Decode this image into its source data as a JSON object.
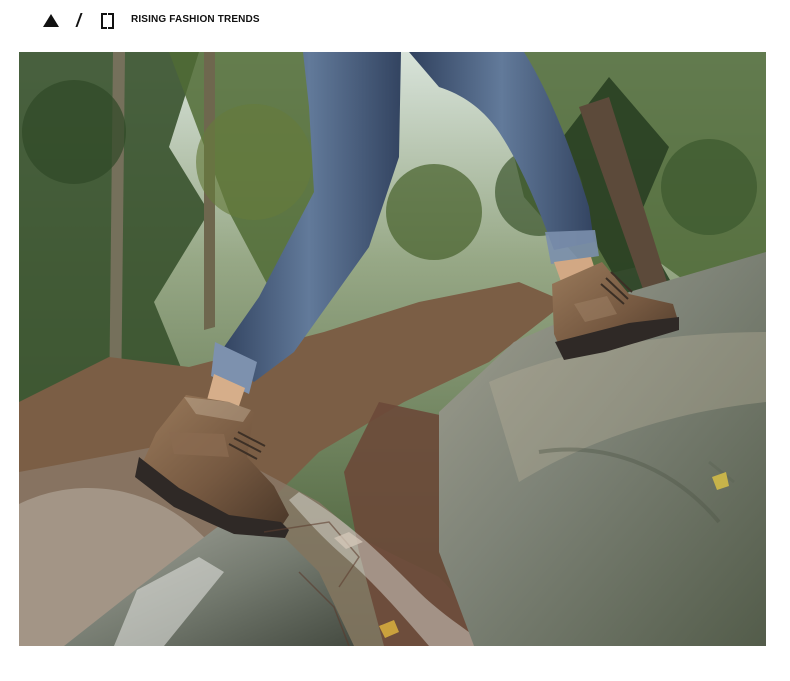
{
  "header": {
    "title": "RISING FASHION TRENDS",
    "icons": [
      "triangle-icon",
      "slash-icon",
      "bracket-icon"
    ]
  },
  "photo": {
    "description_visible": false
  },
  "colors": {
    "foreground": "#111111",
    "background": "#ffffff",
    "forest_green": "#48603a",
    "rock_gray": "#7e8377",
    "denim": "#4a5e7d",
    "boot_brown": "#7a5d45"
  }
}
